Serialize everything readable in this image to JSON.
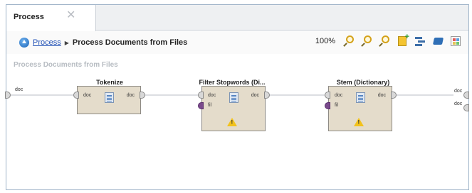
{
  "tab": {
    "label": "Process",
    "close_icon": "close-icon"
  },
  "breadcrumb": {
    "root": "Process",
    "separator": "▶",
    "current": "Process Documents from Files"
  },
  "toolbar": {
    "zoom": "100%"
  },
  "canvas": {
    "title": "Process Documents from Files"
  },
  "source_port": {
    "label": "doc"
  },
  "operators": [
    {
      "title": "Tokenize",
      "in_port": "doc",
      "out_port": "doc"
    },
    {
      "title": "Filter Stopwords (Di...",
      "in_port": "doc",
      "out_port": "doc",
      "extra_port": "fil",
      "warning": true
    },
    {
      "title": "Stem (Dictionary)",
      "in_port": "doc",
      "out_port": "doc",
      "extra_port": "fil",
      "warning": true
    }
  ],
  "sink_ports": [
    {
      "label": "doc"
    },
    {
      "label": "doc"
    }
  ],
  "colors": {
    "operator_fill": "#e4dccb",
    "link": "#1f4fb5",
    "warning": "#f2c21c",
    "port_purple": "#7a4a8c"
  }
}
